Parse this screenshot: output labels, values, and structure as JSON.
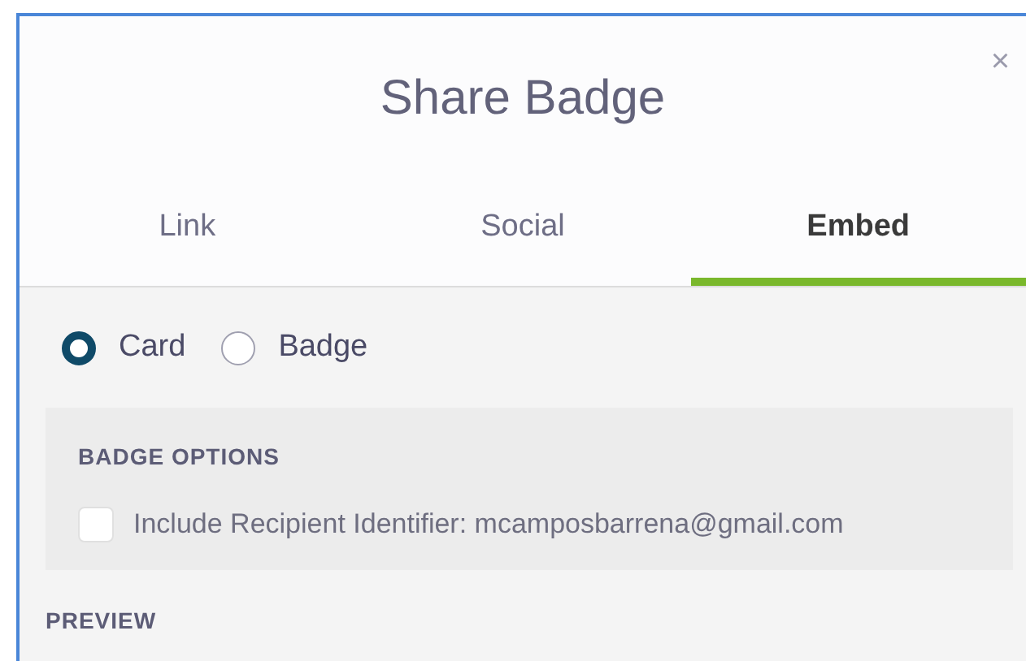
{
  "dialog": {
    "title": "Share Badge",
    "close": "×"
  },
  "tabs": [
    {
      "label": "Link",
      "selected": false
    },
    {
      "label": "Social",
      "selected": false
    },
    {
      "label": "Embed",
      "selected": true
    }
  ],
  "format_options": [
    {
      "label": "Card",
      "selected": true
    },
    {
      "label": "Badge",
      "selected": false
    }
  ],
  "badge_options": {
    "heading": "BADGE OPTIONS",
    "checkbox": {
      "label": "Include Recipient Identifier: mcamposbarrena@gmail.com",
      "checked": false
    }
  },
  "preview": {
    "heading": "PREVIEW"
  }
}
